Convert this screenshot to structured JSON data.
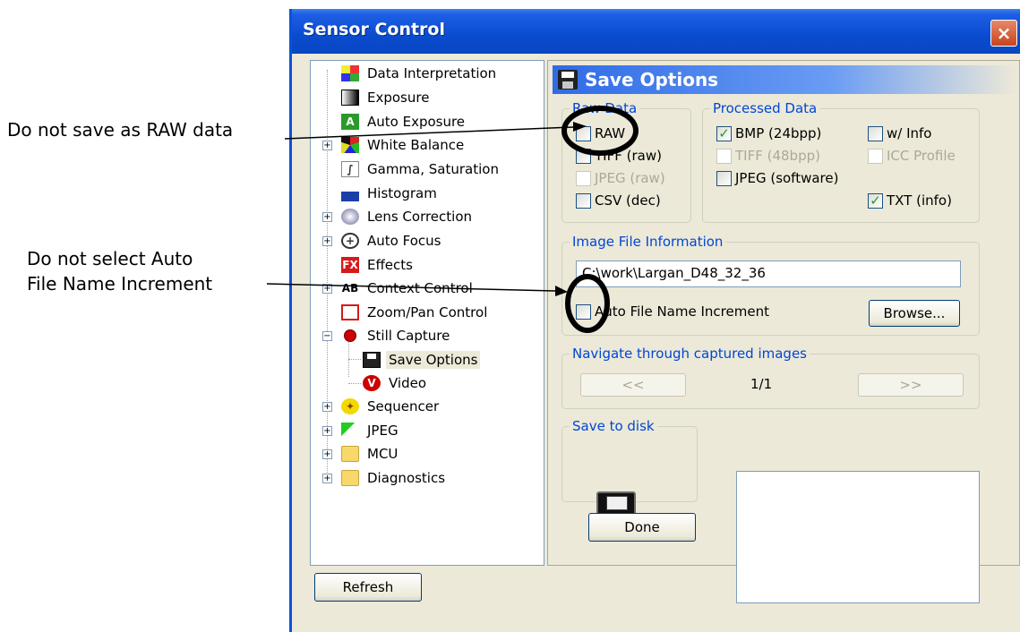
{
  "annotations": {
    "callout1": "Do not save as RAW data",
    "callout2_line1": "Do not select Auto",
    "callout2_line2": "File Name Increment"
  },
  "window": {
    "title": "Sensor Control",
    "close_label": "×"
  },
  "tree": {
    "items": [
      {
        "label": "Data Interpretation",
        "icon": "color-grid-icon"
      },
      {
        "label": "Exposure",
        "icon": "gradient-icon"
      },
      {
        "label": "Auto Exposure",
        "icon": "letter-a-icon"
      },
      {
        "label": "White Balance",
        "icon": "color-palette-icon"
      },
      {
        "label": "Gamma, Saturation",
        "icon": "curve-icon"
      },
      {
        "label": "Histogram",
        "icon": "histogram-icon"
      },
      {
        "label": "Lens Correction",
        "icon": "lens-icon"
      },
      {
        "label": "Auto Focus",
        "icon": "crosshair-icon"
      },
      {
        "label": "Effects",
        "icon": "fx-icon",
        "icon_text": "FX"
      },
      {
        "label": "Context Control",
        "icon": "ab-icon",
        "icon_text": "AB"
      },
      {
        "label": "Zoom/Pan Control",
        "icon": "zoom-box-icon"
      },
      {
        "label": "Still Capture",
        "icon": "still-capture-icon"
      },
      {
        "label": "Save Options",
        "icon": "floppy-icon"
      },
      {
        "label": "Video",
        "icon": "video-icon",
        "icon_text": "V"
      },
      {
        "label": "Sequencer",
        "icon": "sequencer-icon"
      },
      {
        "label": "JPEG",
        "icon": "jpeg-icon"
      },
      {
        "label": "MCU",
        "icon": "folder-icon"
      },
      {
        "label": "Diagnostics",
        "icon": "folder-icon"
      }
    ]
  },
  "save_options": {
    "title": "Save Options",
    "raw_data": {
      "label": "Raw Data",
      "raw": "RAW",
      "tiff_raw": "TIFF (raw)",
      "jpeg_raw": "JPEG (raw)",
      "csv_dec": "CSV (dec)"
    },
    "processed_data": {
      "label": "Processed Data",
      "bmp": "BMP (24bpp)",
      "w_info": "w/ Info",
      "tiff_48": "TIFF (48bpp)",
      "icc_profile": "ICC Profile",
      "jpeg_sw": "JPEG (software)",
      "txt_info": "TXT (info)"
    },
    "image_file_info": {
      "label": "Image File Information",
      "path_value": "C:\\work\\Largan_D48_32_36",
      "auto_increment": "Auto File Name Increment",
      "browse": "Browse..."
    },
    "navigate": {
      "label": "Navigate through captured images",
      "prev": "<<",
      "counter": "1/1",
      "next": ">>"
    },
    "save_to_disk": {
      "label": "Save to disk"
    },
    "done": "Done",
    "check_mark": "✓"
  },
  "refresh": "Refresh"
}
